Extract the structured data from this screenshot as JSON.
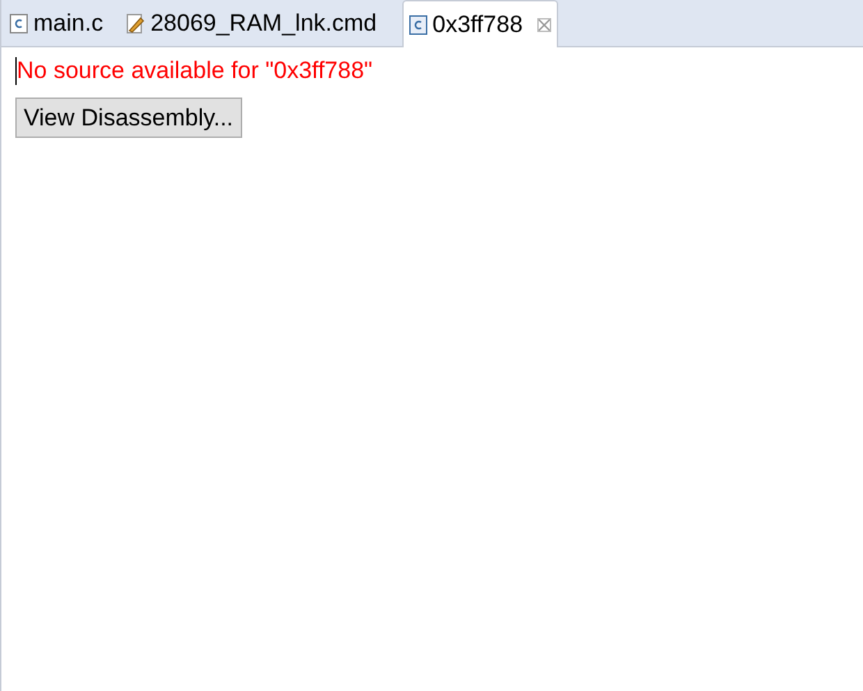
{
  "tabs": [
    {
      "label": "main.c",
      "kind": "source",
      "selected": false
    },
    {
      "label": "28069_RAM_lnk.cmd",
      "kind": "linker",
      "selected": false
    },
    {
      "label": "0x3ff788",
      "kind": "source",
      "selected": true
    }
  ],
  "message": "No source available for \"0x3ff788\"",
  "button": "View Disassembly..."
}
